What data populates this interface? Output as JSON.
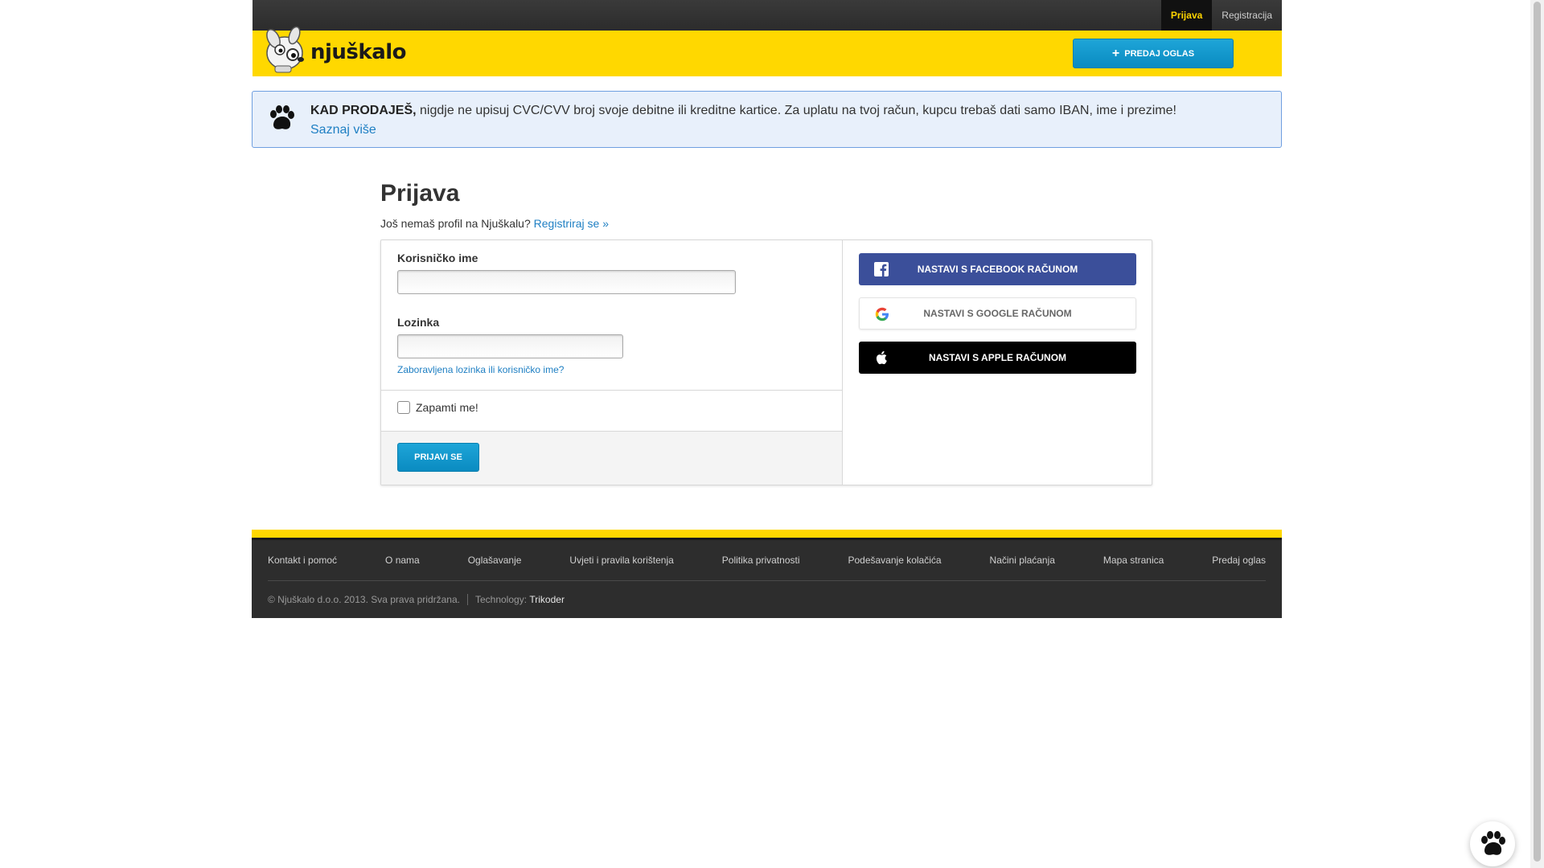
{
  "topbar": {
    "login_label": "Prijava",
    "register_label": "Registracija"
  },
  "header": {
    "logo_text": "njuškalo",
    "sell_button_label": "PREDAJ OGLAS"
  },
  "banner": {
    "bold_text": "KAD PRODAJEŠ,",
    "text": " nigdje ne upisuj CVC/CVV broj svoje debitne ili kreditne kartice. Za uplatu na tvoj račun, kupcu trebaš dati samo IBAN, ime i prezime!",
    "link_label": "Saznaj više"
  },
  "login": {
    "title": "Prijava",
    "no_profile_text": "Još nemaš profil na Njuškalu? ",
    "register_link": "Registriraj se »",
    "username_label": "Korisničko ime",
    "username_value": "",
    "password_label": "Lozinka",
    "password_value": "",
    "forgot_link": "Zaboravljena lozinka ili korisničko ime?",
    "remember_label": "Zapamti me!",
    "submit_label": "PRIJAVI SE"
  },
  "social": {
    "facebook_label": "NASTAVI S FACEBOOK RAČUNOM",
    "google_label": "NASTAVI S GOOGLE RAČUNOM",
    "apple_label": "NASTAVI S APPLE RAČUNOM"
  },
  "footer": {
    "links": [
      "Kontakt i pomoć",
      "O nama",
      "Oglašavanje",
      "Uvjeti i pravila korištenja",
      "Politika privatnosti",
      "Podešavanje kolačića",
      "Načini plaćanja",
      "Mapa stranica",
      "Predaj oglas"
    ],
    "copyright": "© Njuškalo d.o.o. 2013. Sva prava pridržana.",
    "technology_label": "Technology:",
    "technology_link": "Trikoder"
  },
  "colors": {
    "brand_yellow": "#ffd800",
    "accent_blue": "#0a8bc1",
    "facebook_blue": "#3b4f9a",
    "dark_bar": "#2d2d2d"
  },
  "icons": {
    "logo": "dog-mascot-icon",
    "banner": "paw-icon",
    "facebook": "facebook-icon",
    "google": "google-icon",
    "apple": "apple-icon",
    "fab": "paw-icon"
  }
}
